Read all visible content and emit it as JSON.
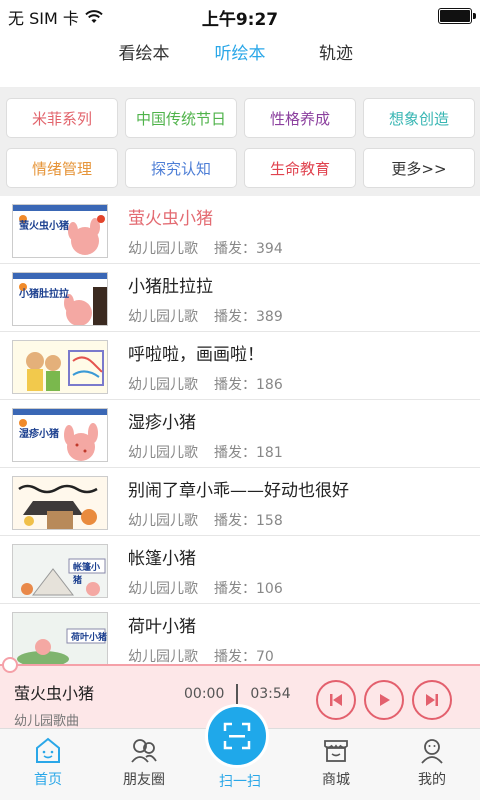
{
  "status": {
    "carrier": "无 SIM 卡",
    "time": "上午9:27"
  },
  "tabs": [
    {
      "label": "看绘本",
      "active": false
    },
    {
      "label": "听绘本",
      "active": true
    },
    {
      "label": "轨迹",
      "active": false
    }
  ],
  "accent_color": "#2aa7e8",
  "categories": [
    {
      "label": "米菲系列",
      "color": "#e2646c"
    },
    {
      "label": "中国传统节日",
      "color": "#4fb34a"
    },
    {
      "label": "性格养成",
      "color": "#8b3f9e"
    },
    {
      "label": "想象创造",
      "color": "#38b6b3"
    },
    {
      "label": "情绪管理",
      "color": "#e6953a"
    },
    {
      "label": "探究认知",
      "color": "#4d7ed6"
    },
    {
      "label": "生命教育",
      "color": "#e0434f"
    },
    {
      "label": "更多>>",
      "color": "#333333"
    }
  ],
  "list": [
    {
      "title": "萤火虫小猪",
      "category": "幼儿园儿歌",
      "plays_label": "播发：394",
      "playing": true,
      "thumb_text": "萤火虫小猪"
    },
    {
      "title": "小猪肚拉拉",
      "category": "幼儿园儿歌",
      "plays_label": "播发：389",
      "playing": false,
      "thumb_text": "小猪肚拉拉"
    },
    {
      "title": "呼啦啦，画画啦！",
      "category": "幼儿园儿歌",
      "plays_label": "播发：186",
      "playing": false,
      "thumb_text": ""
    },
    {
      "title": "湿疹小猪",
      "category": "幼儿园儿歌",
      "plays_label": "播发：181",
      "playing": false,
      "thumb_text": "湿疹小猪"
    },
    {
      "title": "别闹了章小乖——好动也很好",
      "category": "幼儿园儿歌",
      "plays_label": "播发：158",
      "playing": false,
      "thumb_text": ""
    },
    {
      "title": "帐篷小猪",
      "category": "幼儿园儿歌",
      "plays_label": "播发：106",
      "playing": false,
      "thumb_text": "帐篷小猪"
    },
    {
      "title": "荷叶小猪",
      "category": "幼儿园儿歌",
      "plays_label": "播发：70",
      "playing": false,
      "thumb_text": "荷叶小猪"
    }
  ],
  "player": {
    "title": "萤火虫小猪",
    "subtitle": "幼儿园歌曲",
    "current_time": "00:00",
    "duration": "03:54"
  },
  "nav": [
    {
      "label": "首页",
      "icon": "home-icon",
      "active": true
    },
    {
      "label": "朋友圈",
      "icon": "friends-icon",
      "active": false
    },
    {
      "label": "扫一扫",
      "icon": "scan-icon",
      "active": false
    },
    {
      "label": "商城",
      "icon": "store-icon",
      "active": false
    },
    {
      "label": "我的",
      "icon": "profile-icon",
      "active": false
    }
  ]
}
